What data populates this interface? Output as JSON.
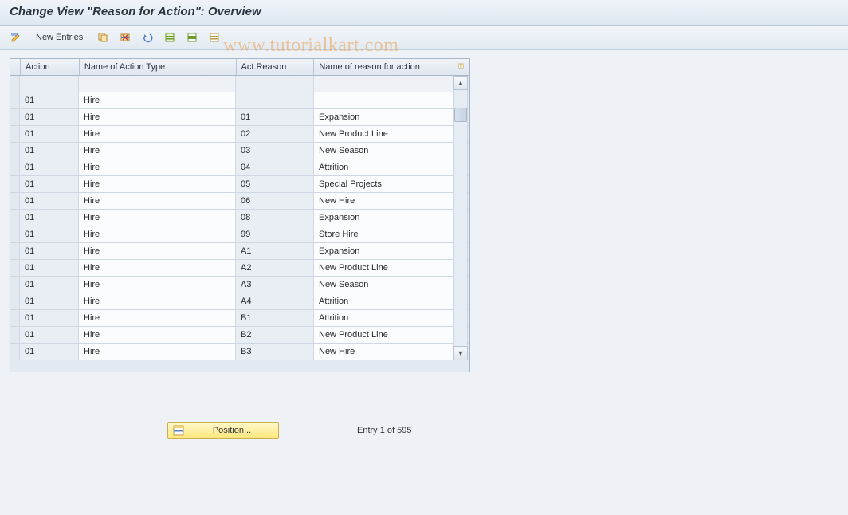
{
  "title": "Change View \"Reason for Action\": Overview",
  "toolbar": {
    "new_entries": "New Entries"
  },
  "watermark": "www.tutorialkart.com",
  "grid": {
    "columns": {
      "action": "Action",
      "name_action_type": "Name of Action Type",
      "act_reason": "Act.Reason",
      "name_reason": "Name of reason for action"
    },
    "rows": [
      {
        "action": "",
        "name_type": "",
        "reason": "",
        "name_reason": ""
      },
      {
        "action": "01",
        "name_type": "Hire",
        "reason": "",
        "name_reason": ""
      },
      {
        "action": "01",
        "name_type": "Hire",
        "reason": "01",
        "name_reason": "Expansion"
      },
      {
        "action": "01",
        "name_type": "Hire",
        "reason": "02",
        "name_reason": "New Product Line"
      },
      {
        "action": "01",
        "name_type": "Hire",
        "reason": "03",
        "name_reason": "New Season"
      },
      {
        "action": "01",
        "name_type": "Hire",
        "reason": "04",
        "name_reason": "Attrition"
      },
      {
        "action": "01",
        "name_type": "Hire",
        "reason": "05",
        "name_reason": "Special Projects"
      },
      {
        "action": "01",
        "name_type": "Hire",
        "reason": "06",
        "name_reason": "New Hire"
      },
      {
        "action": "01",
        "name_type": "Hire",
        "reason": "08",
        "name_reason": "Expansion"
      },
      {
        "action": "01",
        "name_type": "Hire",
        "reason": "99",
        "name_reason": "Store Hire"
      },
      {
        "action": "01",
        "name_type": "Hire",
        "reason": "A1",
        "name_reason": "Expansion"
      },
      {
        "action": "01",
        "name_type": "Hire",
        "reason": "A2",
        "name_reason": "New Product Line"
      },
      {
        "action": "01",
        "name_type": "Hire",
        "reason": "A3",
        "name_reason": "New Season"
      },
      {
        "action": "01",
        "name_type": "Hire",
        "reason": "A4",
        "name_reason": "Attrition"
      },
      {
        "action": "01",
        "name_type": "Hire",
        "reason": "B1",
        "name_reason": "Attrition"
      },
      {
        "action": "01",
        "name_type": "Hire",
        "reason": "B2",
        "name_reason": "New Product Line"
      },
      {
        "action": "01",
        "name_type": "Hire",
        "reason": "B3",
        "name_reason": "New Hire"
      }
    ]
  },
  "footer": {
    "position_label": "Position...",
    "entry_info": "Entry 1 of 595"
  }
}
